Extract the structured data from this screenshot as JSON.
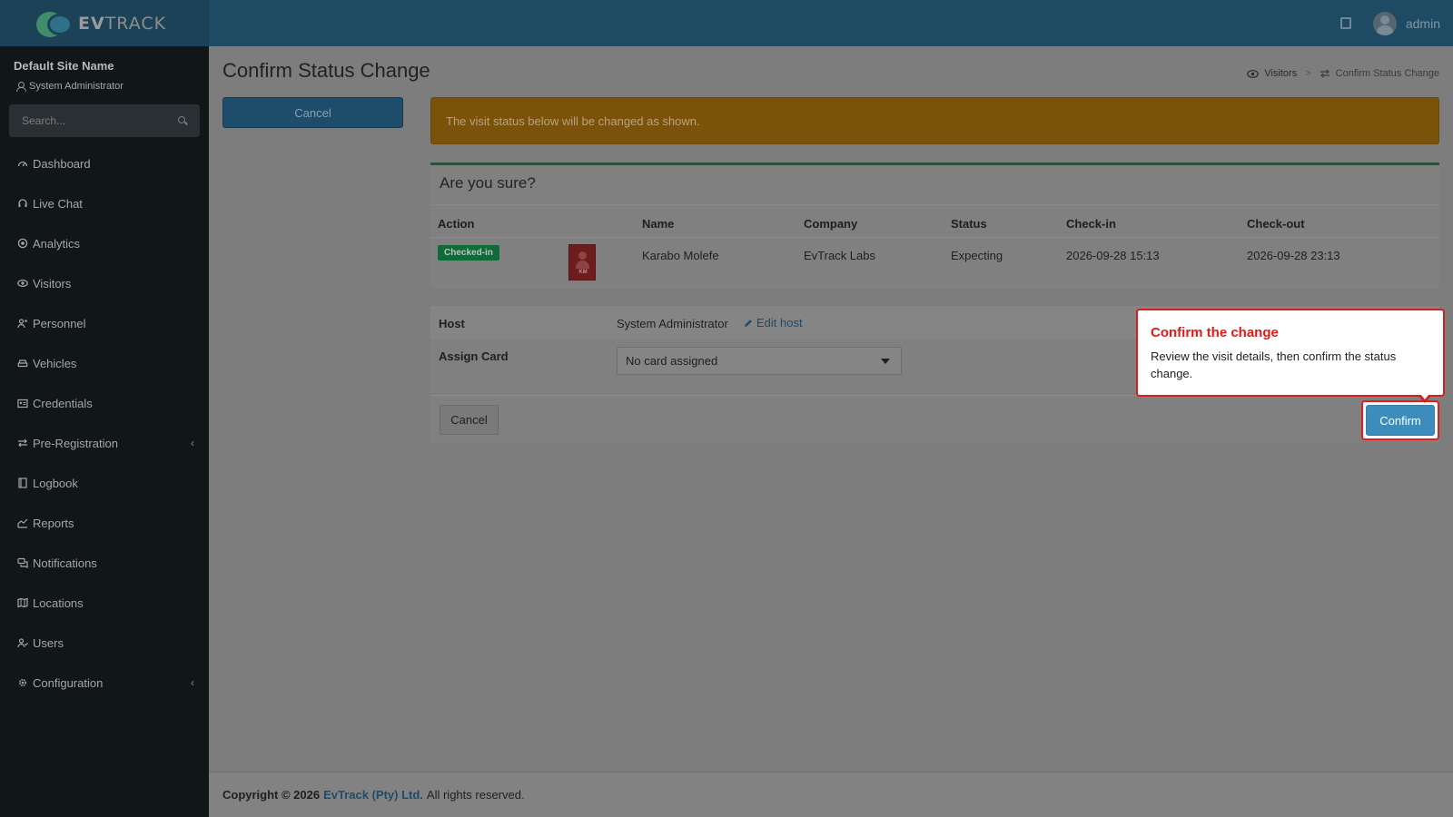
{
  "app": {
    "logo_text_bold": "EV",
    "logo_text_rest": "TRACK",
    "user_name": "admin"
  },
  "sidebar": {
    "site_name": "Default Site Name",
    "role": "System Administrator",
    "search_placeholder": "Search...",
    "items": [
      {
        "label": "Dashboard",
        "icon": "dashboard-icon"
      },
      {
        "label": "Live Chat",
        "icon": "headset-icon"
      },
      {
        "label": "Analytics",
        "icon": "target-icon"
      },
      {
        "label": "Visitors",
        "icon": "eye-icon"
      },
      {
        "label": "Personnel",
        "icon": "personnel-icon"
      },
      {
        "label": "Vehicles",
        "icon": "car-icon"
      },
      {
        "label": "Credentials",
        "icon": "id-card-icon"
      },
      {
        "label": "Pre-Registration",
        "icon": "exchange-icon",
        "has_submenu": true
      },
      {
        "label": "Logbook",
        "icon": "book-icon"
      },
      {
        "label": "Reports",
        "icon": "chart-icon"
      },
      {
        "label": "Notifications",
        "icon": "comments-icon"
      },
      {
        "label": "Locations",
        "icon": "map-icon"
      },
      {
        "label": "Users",
        "icon": "users-icon"
      },
      {
        "label": "Configuration",
        "icon": "gear-icon",
        "has_submenu": true
      }
    ]
  },
  "page": {
    "title": "Confirm Status Change",
    "breadcrumb": {
      "parent": "Visitors",
      "separator": ">",
      "current": "Confirm Status Change"
    },
    "left_cancel_label": "Cancel",
    "alert_text": "The visit status below will be changed as shown."
  },
  "confirm_box": {
    "title": "Are you sure?",
    "columns": [
      "Action",
      "Name",
      "Company",
      "Status",
      "Check-in",
      "Check-out"
    ],
    "row": {
      "action_badge": "Checked-in",
      "photo_initials": "KM",
      "name": "Karabo Molefe",
      "company": "EvTrack Labs",
      "status": "Expecting",
      "check_in": "2026-09-28 15:13",
      "check_out": "2026-09-28 23:13"
    }
  },
  "details": {
    "host_label": "Host",
    "host_value": "System Administrator",
    "edit_host_label": "Edit host",
    "card_label": "Assign Card",
    "card_selected": "No card assigned"
  },
  "actions": {
    "cancel_label": "Cancel",
    "confirm_label": "Confirm"
  },
  "tooltip": {
    "title": "Confirm the change",
    "body": "Review the visit details, then confirm the status change."
  },
  "footer": {
    "copyright": "Copyright © 2026",
    "company": "EvTrack (Pty) Ltd.",
    "rights": "All rights reserved."
  },
  "colors": {
    "topbar": "#1f4a63",
    "sidebar": "#111619",
    "alert": "#7b520a",
    "badge": "#0f6b37",
    "confirm": "#3c8dbc",
    "highlight": "#e41c1c"
  }
}
